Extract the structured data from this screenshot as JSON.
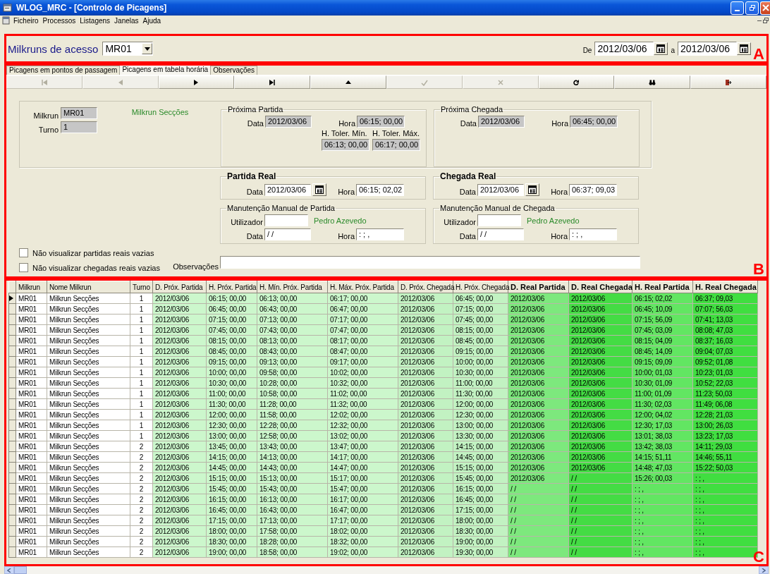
{
  "window": {
    "title": "WLOG_MRC - [Controlo de Picagens]"
  },
  "menu": [
    "Ficheiro",
    "Processos",
    "Listagens",
    "Janelas",
    "Ajuda"
  ],
  "access": {
    "label": "Milkruns de acesso",
    "value": "MR01",
    "from_label": "De",
    "from": "2012/03/06",
    "to_label": "a",
    "to": "2012/03/06"
  },
  "tabs": [
    {
      "label": "Picagens em pontos de passagem",
      "selected": false
    },
    {
      "label": "Picagens em tabela horária",
      "selected": true
    },
    {
      "label": "Observações",
      "selected": false
    }
  ],
  "toolbar": [
    {
      "kind": "first",
      "disabled": true
    },
    {
      "kind": "prev",
      "disabled": true
    },
    {
      "kind": "next",
      "disabled": false
    },
    {
      "kind": "last",
      "disabled": false
    },
    {
      "kind": "up",
      "disabled": false
    },
    {
      "kind": "confirm",
      "disabled": true
    },
    {
      "kind": "cancel",
      "disabled": true
    },
    {
      "kind": "refresh",
      "disabled": false
    },
    {
      "kind": "find",
      "disabled": false
    },
    {
      "kind": "exit",
      "disabled": false
    }
  ],
  "form": {
    "milkrun_label": "Milkrun",
    "milkrun": "MR01",
    "milkrun_name": "Milkrun Secções",
    "turno_label": "Turno",
    "turno": "1",
    "groups": [
      {
        "kind": "plan",
        "title": "Próxima Partida",
        "data_label": "Data",
        "data": "2012/03/06",
        "hora_label": "Hora",
        "hora": "06:15; 00,00",
        "tolerances": [
          {
            "label": "H. Toler. Mín.",
            "value": "06:13; 00,00"
          },
          {
            "label": "H. Toler. Máx.",
            "value": "06:17; 00,00"
          }
        ]
      },
      {
        "kind": "plan",
        "title": "Próxima Chegada",
        "data_label": "Data",
        "data": "2012/03/06",
        "hora_label": "Hora",
        "hora": "06:45; 00,00"
      },
      {
        "kind": "real",
        "title": "Partida Real",
        "data_label": "Data",
        "data": "2012/03/06",
        "hora_label": "Hora",
        "hora": "06:15; 02,02"
      },
      {
        "kind": "real",
        "title": "Chegada Real",
        "data_label": "Data",
        "data": "2012/03/06",
        "hora_label": "Hora",
        "hora": "06:37; 09,03"
      },
      {
        "kind": "manual",
        "title": "Manutenção Manual de Partida",
        "user_label": "Utilizador",
        "user_name": "Pedro Azevedo",
        "data_label": "Data",
        "data": "/ /",
        "hora_label": "Hora",
        "hora": ": ; ,"
      },
      {
        "kind": "manual",
        "title": "Manutenção Manual de Chegada",
        "user_label": "Utilizador",
        "user_name": "Pedro Azevedo",
        "data_label": "Data",
        "data": "/ /",
        "hora_label": "Hora",
        "hora": ": ; ,"
      }
    ],
    "checkboxes": [
      {
        "label": "Não visualizar partidas reais vazias",
        "checked": false
      },
      {
        "label": "Não visualizar chegadas reais vazias",
        "checked": false
      }
    ],
    "obs_label": "Observações"
  },
  "grid": {
    "columns": [
      {
        "label": "Milkrun",
        "kind": "plain",
        "color": "#ffffff"
      },
      {
        "label": "Nome Milkrun",
        "kind": "plain",
        "color": "#ffffff"
      },
      {
        "label": "Turno",
        "kind": "plain",
        "color": "#ffffff"
      },
      {
        "label": "D. Próx. Partida",
        "kind": "plan",
        "color": "#ccf7cc"
      },
      {
        "label": "H. Próx. Partida",
        "kind": "plan",
        "color": "#ccf7cc"
      },
      {
        "label": "H. Mín. Próx. Partida",
        "kind": "plan",
        "color": "#ccf7cc"
      },
      {
        "label": "H. Máx. Próx. Partida",
        "kind": "plan",
        "color": "#ccf7cc"
      },
      {
        "label": "D. Próx. Chegada",
        "kind": "plan",
        "color": "#c2f2c2"
      },
      {
        "label": "H. Próx. Chegada",
        "kind": "plan",
        "color": "#c2f2c2"
      },
      {
        "label": "D. Real Partida",
        "kind": "real",
        "color": "#7de87d"
      },
      {
        "label": "D. Real Chegada",
        "kind": "real",
        "color": "#44dc44"
      },
      {
        "label": "H. Real Partida",
        "kind": "real",
        "color": "#62e662"
      },
      {
        "label": "H. Real Chegada",
        "kind": "real",
        "color": "#40de40"
      }
    ],
    "rows": [
      {
        "selected": true,
        "cells": [
          "MR01",
          "Milkrun Secções",
          "1",
          "2012/03/06",
          "06:15; 00,00",
          "06:13; 00,00",
          "06:17; 00,00",
          "2012/03/06",
          "06:45; 00,00",
          "2012/03/06",
          "2012/03/06",
          "06:15; 02,02",
          "06:37; 09,03"
        ]
      },
      {
        "selected": false,
        "cells": [
          "MR01",
          "Milkrun Secções",
          "1",
          "2012/03/06",
          "06:45; 00,00",
          "06:43; 00,00",
          "06:47; 00,00",
          "2012/03/06",
          "07:15; 00,00",
          "2012/03/06",
          "2012/03/06",
          "06:45; 10,09",
          "07:07; 56,03"
        ]
      },
      {
        "selected": false,
        "cells": [
          "MR01",
          "Milkrun Secções",
          "1",
          "2012/03/06",
          "07:15; 00,00",
          "07:13; 00,00",
          "07:17; 00,00",
          "2012/03/06",
          "07:45; 00,00",
          "2012/03/06",
          "2012/03/06",
          "07:15; 56,09",
          "07:41; 13,03"
        ]
      },
      {
        "selected": false,
        "cells": [
          "MR01",
          "Milkrun Secções",
          "1",
          "2012/03/06",
          "07:45; 00,00",
          "07:43; 00,00",
          "07:47; 00,00",
          "2012/03/06",
          "08:15; 00,00",
          "2012/03/06",
          "2012/03/06",
          "07:45; 03,09",
          "08:08; 47,03"
        ]
      },
      {
        "selected": false,
        "cells": [
          "MR01",
          "Milkrun Secções",
          "1",
          "2012/03/06",
          "08:15; 00,00",
          "08:13; 00,00",
          "08:17; 00,00",
          "2012/03/06",
          "08:45; 00,00",
          "2012/03/06",
          "2012/03/06",
          "08:15; 04,09",
          "08:37; 16,03"
        ]
      },
      {
        "selected": false,
        "cells": [
          "MR01",
          "Milkrun Secções",
          "1",
          "2012/03/06",
          "08:45; 00,00",
          "08:43; 00,00",
          "08:47; 00,00",
          "2012/03/06",
          "09:15; 00,00",
          "2012/03/06",
          "2012/03/06",
          "08:45; 14,09",
          "09:04; 07,03"
        ]
      },
      {
        "selected": false,
        "cells": [
          "MR01",
          "Milkrun Secções",
          "1",
          "2012/03/06",
          "09:15; 00,00",
          "09:13; 00,00",
          "09:17; 00,00",
          "2012/03/06",
          "10:00; 00,00",
          "2012/03/06",
          "2012/03/06",
          "09:15; 09,09",
          "09:52; 01,08"
        ]
      },
      {
        "selected": false,
        "cells": [
          "MR01",
          "Milkrun Secções",
          "1",
          "2012/03/06",
          "10:00; 00,00",
          "09:58; 00,00",
          "10:02; 00,00",
          "2012/03/06",
          "10:30; 00,00",
          "2012/03/06",
          "2012/03/06",
          "10:00; 01,03",
          "10:23; 01,03"
        ]
      },
      {
        "selected": false,
        "cells": [
          "MR01",
          "Milkrun Secções",
          "1",
          "2012/03/06",
          "10:30; 00,00",
          "10:28; 00,00",
          "10:32; 00,00",
          "2012/03/06",
          "11:00; 00,00",
          "2012/03/06",
          "2012/03/06",
          "10:30; 01,09",
          "10:52; 22,03"
        ]
      },
      {
        "selected": false,
        "cells": [
          "MR01",
          "Milkrun Secções",
          "1",
          "2012/03/06",
          "11:00; 00,00",
          "10:58; 00,00",
          "11:02; 00,00",
          "2012/03/06",
          "11:30; 00,00",
          "2012/03/06",
          "2012/03/06",
          "11:00; 01,09",
          "11:23; 50,03"
        ]
      },
      {
        "selected": false,
        "cells": [
          "MR01",
          "Milkrun Secções",
          "1",
          "2012/03/06",
          "11:30; 00,00",
          "11:28; 00,00",
          "11:32; 00,00",
          "2012/03/06",
          "12:00; 00,00",
          "2012/03/06",
          "2012/03/06",
          "11:30; 02,03",
          "11:49; 06,08"
        ]
      },
      {
        "selected": false,
        "cells": [
          "MR01",
          "Milkrun Secções",
          "1",
          "2012/03/06",
          "12:00; 00,00",
          "11:58; 00,00",
          "12:02; 00,00",
          "2012/03/06",
          "12:30; 00,00",
          "2012/03/06",
          "2012/03/06",
          "12:00; 04,02",
          "12:28; 21,03"
        ]
      },
      {
        "selected": false,
        "cells": [
          "MR01",
          "Milkrun Secções",
          "1",
          "2012/03/06",
          "12:30; 00,00",
          "12:28; 00,00",
          "12:32; 00,00",
          "2012/03/06",
          "13:00; 00,00",
          "2012/03/06",
          "2012/03/06",
          "12:30; 17,03",
          "13:00; 26,03"
        ]
      },
      {
        "selected": false,
        "cells": [
          "MR01",
          "Milkrun Secções",
          "1",
          "2012/03/06",
          "13:00; 00,00",
          "12:58; 00,00",
          "13:02; 00,00",
          "2012/03/06",
          "13:30; 00,00",
          "2012/03/06",
          "2012/03/06",
          "13:01; 38,03",
          "13:23; 17,03"
        ]
      },
      {
        "selected": false,
        "cells": [
          "MR01",
          "Milkrun Secções",
          "2",
          "2012/03/06",
          "13:45; 00,00",
          "13:43; 00,00",
          "13:47; 00,00",
          "2012/03/06",
          "14:15; 00,00",
          "2012/03/06",
          "2012/03/06",
          "13:42; 38,03",
          "14:11; 29,03"
        ]
      },
      {
        "selected": false,
        "cells": [
          "MR01",
          "Milkrun Secções",
          "2",
          "2012/03/06",
          "14:15; 00,00",
          "14:13; 00,00",
          "14:17; 00,00",
          "2012/03/06",
          "14:45; 00,00",
          "2012/03/06",
          "2012/03/06",
          "14:15; 51,11",
          "14:46; 55,11"
        ]
      },
      {
        "selected": false,
        "cells": [
          "MR01",
          "Milkrun Secções",
          "2",
          "2012/03/06",
          "14:45; 00,00",
          "14:43; 00,00",
          "14:47; 00,00",
          "2012/03/06",
          "15:15; 00,00",
          "2012/03/06",
          "2012/03/06",
          "14:48; 47,03",
          "15:22; 50,03"
        ]
      },
      {
        "selected": false,
        "cells": [
          "MR01",
          "Milkrun Secções",
          "2",
          "2012/03/06",
          "15:15; 00,00",
          "15:13; 00,00",
          "15:17; 00,00",
          "2012/03/06",
          "15:45; 00,00",
          "2012/03/06",
          "/ /",
          "15:26; 00,03",
          ": ; ,"
        ]
      },
      {
        "selected": false,
        "cells": [
          "MR01",
          "Milkrun Secções",
          "2",
          "2012/03/06",
          "15:45; 00,00",
          "15:43; 00,00",
          "15:47; 00,00",
          "2012/03/06",
          "16:15; 00,00",
          "/ /",
          "/ /",
          ": ; ,",
          ": ; ,"
        ]
      },
      {
        "selected": false,
        "cells": [
          "MR01",
          "Milkrun Secções",
          "2",
          "2012/03/06",
          "16:15; 00,00",
          "16:13; 00,00",
          "16:17; 00,00",
          "2012/03/06",
          "16:45; 00,00",
          "/ /",
          "/ /",
          ": ; ,",
          ": ; ,"
        ]
      },
      {
        "selected": false,
        "cells": [
          "MR01",
          "Milkrun Secções",
          "2",
          "2012/03/06",
          "16:45; 00,00",
          "16:43; 00,00",
          "16:47; 00,00",
          "2012/03/06",
          "17:15; 00,00",
          "/ /",
          "/ /",
          ": ; ,",
          ": ; ,"
        ]
      },
      {
        "selected": false,
        "cells": [
          "MR01",
          "Milkrun Secções",
          "2",
          "2012/03/06",
          "17:15; 00,00",
          "17:13; 00,00",
          "17:17; 00,00",
          "2012/03/06",
          "18:00; 00,00",
          "/ /",
          "/ /",
          ": ; ,",
          ": ; ,"
        ]
      },
      {
        "selected": false,
        "cells": [
          "MR01",
          "Milkrun Secções",
          "2",
          "2012/03/06",
          "18:00; 00,00",
          "17:58; 00,00",
          "18:02; 00,00",
          "2012/03/06",
          "18:30; 00,00",
          "/ /",
          "/ /",
          ": ; ,",
          ": ; ,"
        ]
      },
      {
        "selected": false,
        "cells": [
          "MR01",
          "Milkrun Secções",
          "2",
          "2012/03/06",
          "18:30; 00,00",
          "18:28; 00,00",
          "18:32; 00,00",
          "2012/03/06",
          "19:00; 00,00",
          "/ /",
          "/ /",
          ": ; ,",
          ": ; ,"
        ]
      },
      {
        "selected": false,
        "cells": [
          "MR01",
          "Milkrun Secções",
          "2",
          "2012/03/06",
          "19:00; 00,00",
          "18:58; 00,00",
          "19:02; 00,00",
          "2012/03/06",
          "19:30; 00,00",
          "/ /",
          "/ /",
          ": ; ,",
          ": ; ,"
        ]
      }
    ]
  },
  "annotations": [
    {
      "label": "A"
    },
    {
      "label": "B"
    },
    {
      "label": "C"
    }
  ]
}
